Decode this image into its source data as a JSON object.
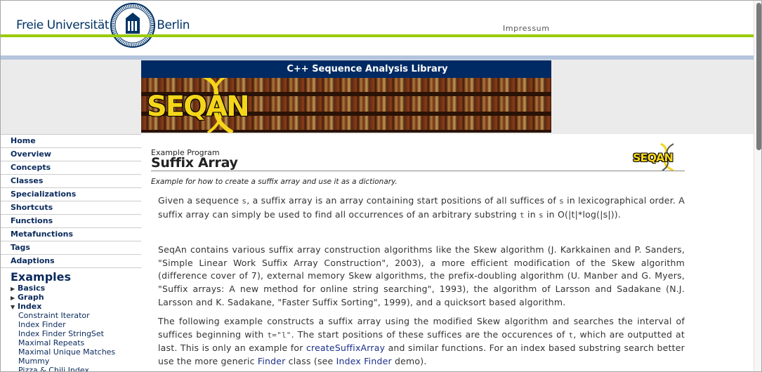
{
  "header": {
    "brand_left": "Freie Universität",
    "brand_right": "Berlin",
    "impressum_label": "Impressum"
  },
  "banner": {
    "title": "C++ Sequence Analysis Library",
    "logo_text": "SEQAN"
  },
  "sidebar": {
    "nav_items": [
      {
        "label": "Home"
      },
      {
        "label": "Overview"
      },
      {
        "label": "Concepts"
      },
      {
        "label": "Classes"
      },
      {
        "label": "Specializations"
      },
      {
        "label": "Shortcuts"
      },
      {
        "label": "Functions"
      },
      {
        "label": "Metafunctions"
      },
      {
        "label": "Tags"
      },
      {
        "label": "Adaptions"
      }
    ],
    "examples_heading": "Examples",
    "tree": [
      {
        "label": "Basics",
        "arrow": "▶"
      },
      {
        "label": "Graph",
        "arrow": "▶"
      },
      {
        "label": "Index",
        "arrow": "▼"
      }
    ],
    "index_children": [
      {
        "label": "Constraint Iterator"
      },
      {
        "label": "Index Finder"
      },
      {
        "label": "Index Finder StringSet"
      },
      {
        "label": "Maximal Repeats"
      },
      {
        "label": "Maximal Unique Matches"
      },
      {
        "label": "Mummy"
      },
      {
        "label": "Pizza & Chili Index"
      }
    ]
  },
  "main": {
    "program_label": "Example Program",
    "title": "Suffix Array",
    "logo_text": "SEQAN",
    "subtitle": "Example for how to create a suffix array and use it as a dictionary.",
    "para1": {
      "t1": "Given a sequence ",
      "c1": "s",
      "t2": ", a suffix array is an array containing start positions of all suffices of ",
      "c2": "s",
      "t3": " in lexicographical order. A suffix array can simply be used to find all occurrences of an arbitrary substring ",
      "c3": "t",
      "t4": " in ",
      "c4": "s",
      "t5": " in O(|t|*log(|s|))."
    },
    "para2": "SeqAn contains various suffix array construction algorithms like the Skew algorithm (J. Karkkainen and P. Sanders, \"Simple Linear Work Suffix Array Construction\", 2003), a more efficient modification of the Skew algorithm (difference cover of 7), external memory Skew algorithms, the prefix-doubling algorithm (U. Manber and G. Myers, \"Suffix arrays: A new method for online string searching\", 1993), the algorithm of Larsson and Sadakane (N.J. Larsson and K. Sadakane, \"Faster Suffix Sorting\", 1999), and a quicksort based algorithm.",
    "para3": {
      "t1": "The following example constructs a suffix array using the modified Skew algorithm and searches the interval of suffices beginning with ",
      "c1": "t=\"l\"",
      "t2": ". The start positions of these suffices are the occurences of ",
      "c2": "t",
      "t3": ", which are outputted at last. This is only an example for ",
      "l1": "createSuffixArray",
      "t4": " and similar functions. For an index based substring search better use the more generic ",
      "l2": "Finder",
      "t5": " class (see ",
      "l3": "Index Finder",
      "t6": " demo)."
    }
  },
  "colors": {
    "green_line": "#99cc00",
    "banner_navy": "#002a64",
    "nav_text": "#0a2a5c",
    "link": "#1a2f8a",
    "logo_yellow": "#f5d51a"
  }
}
